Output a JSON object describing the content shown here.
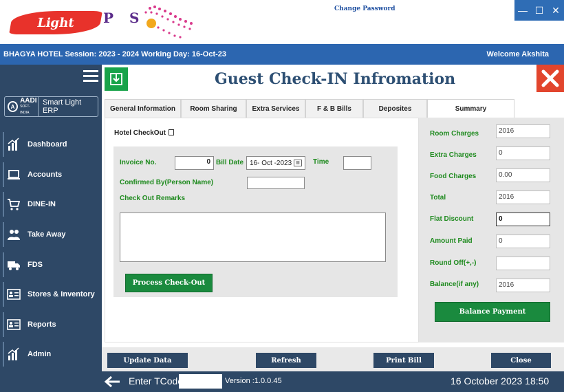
{
  "header": {
    "logo_word": "Light",
    "logo_pos": "P S",
    "change_password": "Change Password"
  },
  "window_controls": {
    "minimize": "—",
    "maximize": "☐",
    "close": "✕"
  },
  "session": {
    "info": "BHAGYA HOTEL  Session:  2023 - 2024 Working Day: 16-Oct-23",
    "welcome": "Welcome  Akshita"
  },
  "brand": {
    "aadi": "AADI",
    "aadi_sub": "SOFT-INDIA",
    "erp": "Smart Light ERP"
  },
  "sidebar": {
    "items": [
      {
        "label": "Dashboard",
        "icon": "bar-chart-icon"
      },
      {
        "label": "Accounts",
        "icon": "laptop-icon"
      },
      {
        "label": "DINE-IN",
        "icon": "cart-icon"
      },
      {
        "label": "Take Away",
        "icon": "users-icon"
      },
      {
        "label": "FDS",
        "icon": "truck-icon"
      },
      {
        "label": "Stores & Inventory",
        "icon": "id-card-icon"
      },
      {
        "label": "Reports",
        "icon": "id-card-icon"
      },
      {
        "label": "Admin",
        "icon": "bar-chart-icon"
      }
    ]
  },
  "page": {
    "title": "Guest Check-IN Infromation"
  },
  "tabs": [
    "General  Information",
    "Room Sharing",
    "Extra Services",
    "F & B Bills",
    "Deposites",
    "Summary"
  ],
  "checkout": {
    "hotel_checkout_label": "Hotel CheckOut",
    "invoice_label": "Invoice No.",
    "invoice_value": "0",
    "bill_date_label": "Bill Date",
    "bill_date_value": "16- Oct -2023",
    "time_label": "Time",
    "time_value": "",
    "confirmed_by_label": "Confirmed By(Person Name)",
    "confirmed_by_value": "",
    "remarks_label": "Check Out Remarks",
    "process_button": "Process Check-Out"
  },
  "summary": {
    "room_charges_label": "Room Charges",
    "room_charges": "2016",
    "extra_charges_label": "Extra Charges",
    "extra_charges": "0",
    "food_charges_label": "Food Charges",
    "food_charges": "0.00",
    "total_label": "Total",
    "total": "2016",
    "flat_discount_label": "Flat Discount",
    "flat_discount": "0",
    "amount_paid_label": "Amount Paid",
    "amount_paid": "0",
    "round_off_label": "Round Off(+,-)",
    "round_off": "",
    "balance_label": "Balance(if any)",
    "balance": "2016",
    "balance_payment_button": "Balance Payment"
  },
  "actions": {
    "update": "Update Data",
    "refresh": "Refresh",
    "print": "Print Bill",
    "close": "Close"
  },
  "footer": {
    "tcode_label": "Enter TCode",
    "version": "Version :1.0.0.45",
    "datetime": "16 October 2023   18:50"
  },
  "colors": {
    "sidebar": "#2e4866",
    "session_bar": "#2c66b0",
    "label_green": "#1e8a1e",
    "button_green": "#1a8a3e",
    "close_red": "#e2452d"
  }
}
